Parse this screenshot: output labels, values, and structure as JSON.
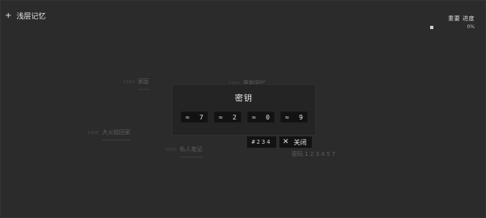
{
  "header": {
    "add_icon": "plus-icon",
    "title": "浅层记忆"
  },
  "progress": {
    "label": "重要 进度",
    "percent_text": "0%",
    "value": 0
  },
  "background_nodes": [
    {
      "meta": "1993",
      "label": "家庭"
    },
    {
      "meta": "1995",
      "label": "童年回忆"
    },
    {
      "meta": "1998",
      "label": "大火前回家"
    },
    {
      "meta": "2003",
      "label": "私人笔记"
    },
    {
      "meta": "",
      "label": "密码 1 2 3 4 5 7"
    }
  ],
  "modal": {
    "title": "密钥",
    "slots": [
      {
        "icon": "approx-icon",
        "symbol": "≈",
        "value": "7"
      },
      {
        "icon": "approx-icon",
        "symbol": "≈",
        "value": "2"
      },
      {
        "icon": "approx-icon",
        "symbol": "≈",
        "value": "0"
      },
      {
        "icon": "approx-icon",
        "symbol": "≈",
        "value": "9"
      }
    ]
  },
  "controls": {
    "code_value": "#234",
    "close_label": "关闭",
    "close_icon": "close-icon"
  }
}
